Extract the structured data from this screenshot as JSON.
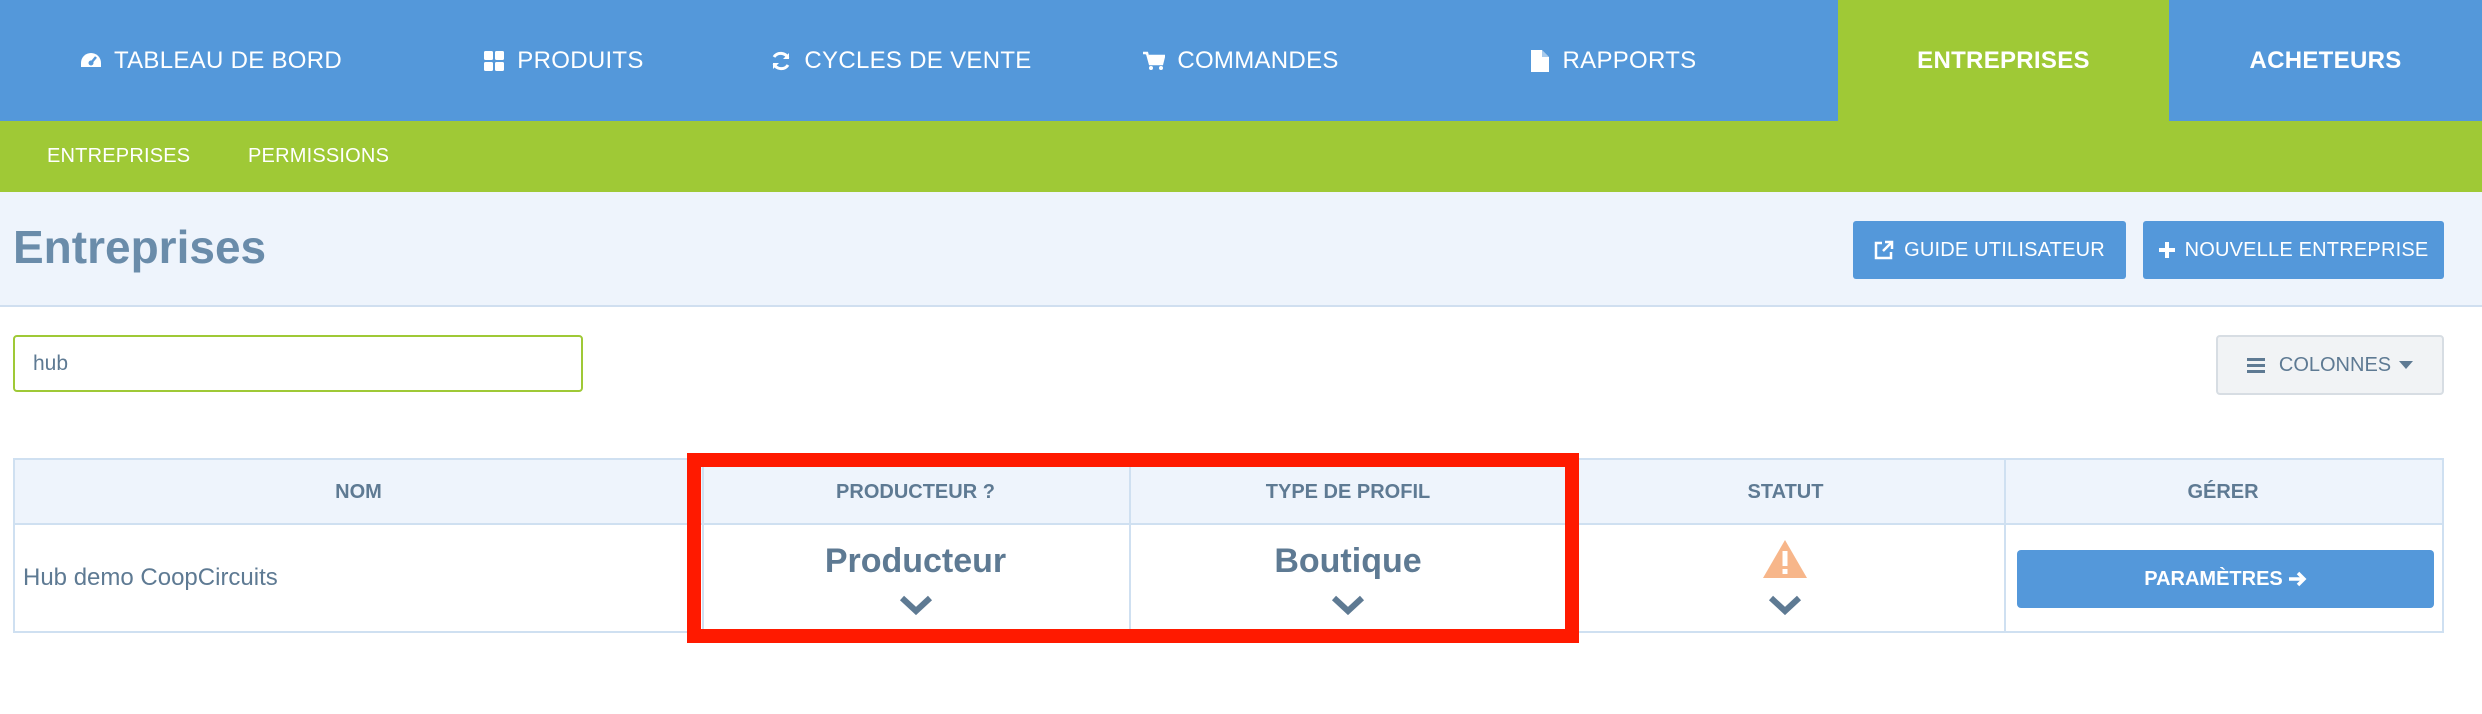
{
  "nav": {
    "items": [
      {
        "label": "TABLEAU DE BORD",
        "icon": "dashboard-icon"
      },
      {
        "label": "PRODUITS",
        "icon": "grid-icon"
      },
      {
        "label": "CYCLES DE VENTE",
        "icon": "refresh-icon"
      },
      {
        "label": "COMMANDES",
        "icon": "cart-icon"
      },
      {
        "label": "RAPPORTS",
        "icon": "file-icon"
      },
      {
        "label": "ENTREPRISES",
        "icon": null,
        "active": true
      },
      {
        "label": "ACHETEURS",
        "icon": null
      }
    ]
  },
  "subnav": {
    "items": [
      {
        "label": "ENTREPRISES",
        "active": true
      },
      {
        "label": "PERMISSIONS"
      }
    ]
  },
  "header": {
    "title": "Entreprises",
    "guide_label": "GUIDE UTILISATEUR",
    "new_label": "NOUVELLE ENTREPRISE"
  },
  "search": {
    "value": "hub"
  },
  "columns_button": {
    "label": "COLONNES"
  },
  "table": {
    "headers": [
      "NOM",
      "PRODUCTEUR ?",
      "TYPE DE PROFIL",
      "STATUT",
      "GÉRER"
    ],
    "rows": [
      {
        "name": "Hub demo CoopCircuits",
        "producer": "Producteur",
        "profile_type": "Boutique",
        "status_icon": "warning-icon",
        "manage_label": "PARAMÈTRES"
      }
    ]
  },
  "colors": {
    "nav_blue": "#5498da",
    "accent_green": "#9fc936",
    "highlight_red": "#ff1a00",
    "warning_orange": "#f7b68a"
  }
}
